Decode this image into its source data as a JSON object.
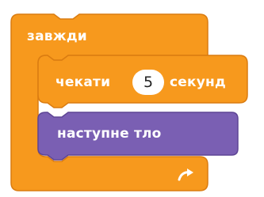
{
  "blocks": {
    "forever": {
      "label": "завжди",
      "loop_icon": "loop-arrow-icon",
      "color": "#F7991D",
      "edge_color": "#DA7C11"
    },
    "wait": {
      "label_before": "чекати",
      "value": "5",
      "label_after": "секунд",
      "color": "#F7991D",
      "edge_color": "#DA7C11"
    },
    "next_backdrop": {
      "label": "наступне  тло",
      "color": "#7A5FB3",
      "edge_color": "#5E4595"
    }
  }
}
